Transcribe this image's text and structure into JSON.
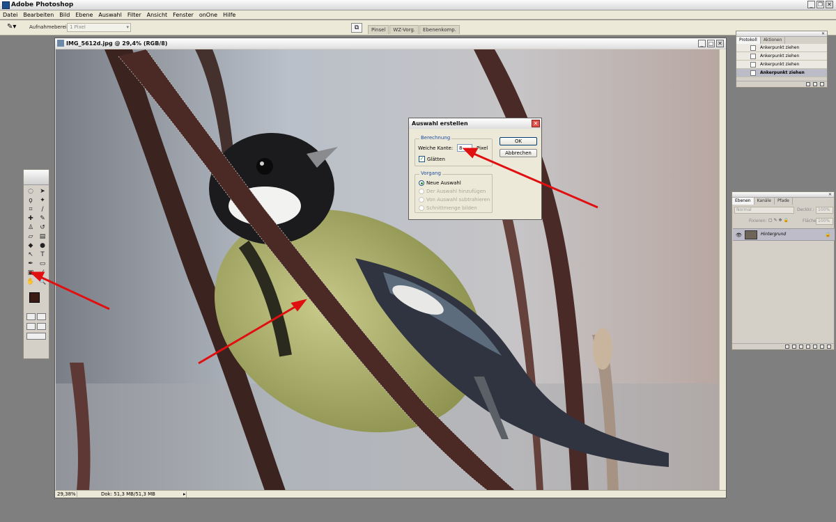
{
  "app": {
    "title": "Adobe Photoshop"
  },
  "menu": [
    "Datei",
    "Bearbeiten",
    "Bild",
    "Ebene",
    "Auswahl",
    "Filter",
    "Ansicht",
    "Fenster",
    "onOne",
    "Hilfe"
  ],
  "options": {
    "label": "Aufnahmebereich:",
    "value": "1 Pixel",
    "tabs": [
      "Pinsel",
      "WZ-Vorg.",
      "Ebenenkomp."
    ]
  },
  "document": {
    "title": "IMG_5612d.jpg @ 29,4% (RGB/8)",
    "zoom": "29,38%",
    "info": "Dok: 51,3 MB/51,3 MB"
  },
  "dialog": {
    "title": "Auswahl erstellen",
    "group1": "Berechnung",
    "feather_label": "Weiche Kante:",
    "feather_value": "8",
    "feather_unit": "Pixel",
    "antialias_label": "Glätten",
    "group2": "Vorgang",
    "options": [
      "Neue Auswahl",
      "Der Auswahl hinzufügen",
      "Von Auswahl subtrahieren",
      "Schnittmenge bilden"
    ],
    "ok": "OK",
    "cancel": "Abbrechen"
  },
  "history_panel": {
    "tabs": [
      "Protokoll",
      "Aktionen"
    ],
    "items": [
      "Ankerpunkt ziehen",
      "Ankerpunkt ziehen",
      "Ankerpunkt ziehen",
      "Ankerpunkt ziehen"
    ]
  },
  "layers_panel": {
    "tabs": [
      "Ebenen",
      "Kanäle",
      "Pfade"
    ],
    "blend_mode": "Normal",
    "opacity_label": "Deckkr.:",
    "opacity": "100%",
    "lock_label": "Fixieren:",
    "fill_label": "Fläche:",
    "fill": "100%",
    "layer_name": "Hintergrund"
  },
  "colors": {
    "foreground": "#3a1a12",
    "background": "#ffffff",
    "arrow": "#e01010"
  }
}
